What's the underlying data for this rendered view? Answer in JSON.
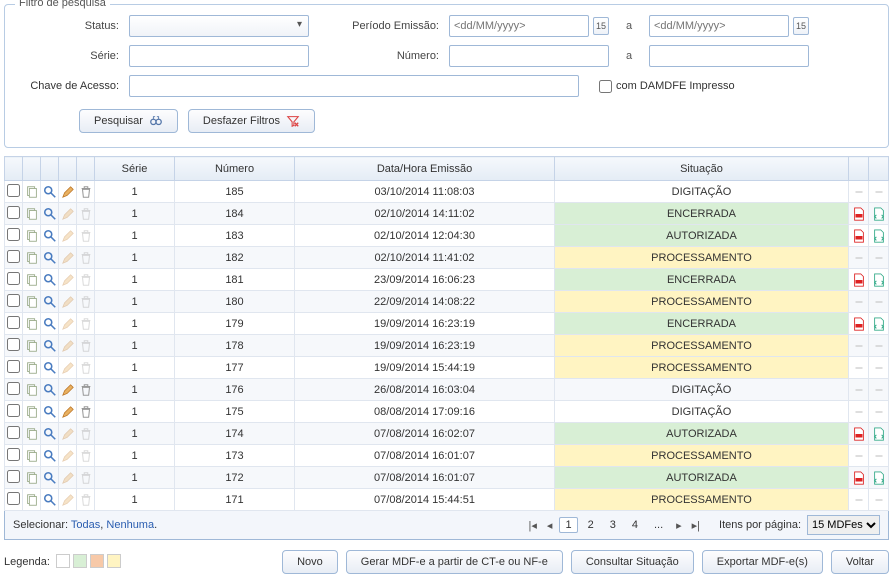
{
  "filter": {
    "legend": "Filtro de pesquisa",
    "status_label": "Status:",
    "serie_label": "Série:",
    "chave_label": "Chave de Acesso:",
    "periodo_label": "Período Emissão:",
    "numero_label": "Número:",
    "date_placeholder": "<dd/MM/yyyy>",
    "cal_glyph": "15",
    "a": "a",
    "com_damdfe": "com DAMDFE Impresso",
    "pesquisar": "Pesquisar",
    "desfazer": "Desfazer Filtros"
  },
  "table": {
    "headers": {
      "serie": "Série",
      "numero": "Número",
      "data": "Data/Hora Emissão",
      "sit": "Situação"
    },
    "rows": [
      {
        "serie": "1",
        "numero": "185",
        "data": "03/10/2014 11:08:03",
        "sit": "DIGITAÇÃO",
        "sit_cls": "DIGITACAO",
        "edit": true,
        "del": true,
        "pdf": false,
        "xml": false
      },
      {
        "serie": "1",
        "numero": "184",
        "data": "02/10/2014 14:11:02",
        "sit": "ENCERRADA",
        "sit_cls": "ENCERRADA",
        "edit": false,
        "del": false,
        "pdf": true,
        "xml": true
      },
      {
        "serie": "1",
        "numero": "183",
        "data": "02/10/2014 12:04:30",
        "sit": "AUTORIZADA",
        "sit_cls": "AUTORIZADA",
        "edit": false,
        "del": false,
        "pdf": true,
        "xml": true
      },
      {
        "serie": "1",
        "numero": "182",
        "data": "02/10/2014 11:41:02",
        "sit": "PROCESSAMENTO",
        "sit_cls": "PROCESSAMENTO",
        "edit": false,
        "del": false,
        "pdf": false,
        "xml": false
      },
      {
        "serie": "1",
        "numero": "181",
        "data": "23/09/2014 16:06:23",
        "sit": "ENCERRADA",
        "sit_cls": "ENCERRADA",
        "edit": false,
        "del": false,
        "pdf": true,
        "xml": true
      },
      {
        "serie": "1",
        "numero": "180",
        "data": "22/09/2014 14:08:22",
        "sit": "PROCESSAMENTO",
        "sit_cls": "PROCESSAMENTO",
        "edit": false,
        "del": false,
        "pdf": false,
        "xml": false
      },
      {
        "serie": "1",
        "numero": "179",
        "data": "19/09/2014 16:23:19",
        "sit": "ENCERRADA",
        "sit_cls": "ENCERRADA",
        "edit": false,
        "del": false,
        "pdf": true,
        "xml": true
      },
      {
        "serie": "1",
        "numero": "178",
        "data": "19/09/2014 16:23:19",
        "sit": "PROCESSAMENTO",
        "sit_cls": "PROCESSAMENTO",
        "edit": false,
        "del": false,
        "pdf": false,
        "xml": false
      },
      {
        "serie": "1",
        "numero": "177",
        "data": "19/09/2014 15:44:19",
        "sit": "PROCESSAMENTO",
        "sit_cls": "PROCESSAMENTO",
        "edit": false,
        "del": false,
        "pdf": false,
        "xml": false
      },
      {
        "serie": "1",
        "numero": "176",
        "data": "26/08/2014 16:03:04",
        "sit": "DIGITAÇÃO",
        "sit_cls": "DIGITACAO",
        "edit": true,
        "del": true,
        "pdf": false,
        "xml": false
      },
      {
        "serie": "1",
        "numero": "175",
        "data": "08/08/2014 17:09:16",
        "sit": "DIGITAÇÃO",
        "sit_cls": "DIGITACAO",
        "edit": true,
        "del": true,
        "pdf": false,
        "xml": false
      },
      {
        "serie": "1",
        "numero": "174",
        "data": "07/08/2014 16:02:07",
        "sit": "AUTORIZADA",
        "sit_cls": "AUTORIZADA",
        "edit": false,
        "del": false,
        "pdf": true,
        "xml": true
      },
      {
        "serie": "1",
        "numero": "173",
        "data": "07/08/2014 16:01:07",
        "sit": "PROCESSAMENTO",
        "sit_cls": "PROCESSAMENTO",
        "edit": false,
        "del": false,
        "pdf": false,
        "xml": false
      },
      {
        "serie": "1",
        "numero": "172",
        "data": "07/08/2014 16:01:07",
        "sit": "AUTORIZADA",
        "sit_cls": "AUTORIZADA",
        "edit": false,
        "del": false,
        "pdf": true,
        "xml": true
      },
      {
        "serie": "1",
        "numero": "171",
        "data": "07/08/2014 15:44:51",
        "sit": "PROCESSAMENTO",
        "sit_cls": "PROCESSAMENTO",
        "edit": false,
        "del": false,
        "pdf": false,
        "xml": false
      }
    ]
  },
  "footer": {
    "selecionar": "Selecionar:",
    "todas": "Todas",
    "nenhuma": "Nenhuma",
    "pages": [
      "1",
      "2",
      "3",
      "4",
      "..."
    ],
    "itens_label": "Itens por página:",
    "itens_value": "15 MDFes"
  },
  "bottom": {
    "legenda": "Legenda:",
    "swatches": [
      "#ffffff",
      "#d8efd5",
      "#f7c9a8",
      "#fff4c2"
    ],
    "novo": "Novo",
    "gerar": "Gerar MDF-e a partir de CT-e ou NF-e",
    "consultar": "Consultar Situação",
    "exportar": "Exportar MDF-e(s)",
    "voltar": "Voltar"
  }
}
